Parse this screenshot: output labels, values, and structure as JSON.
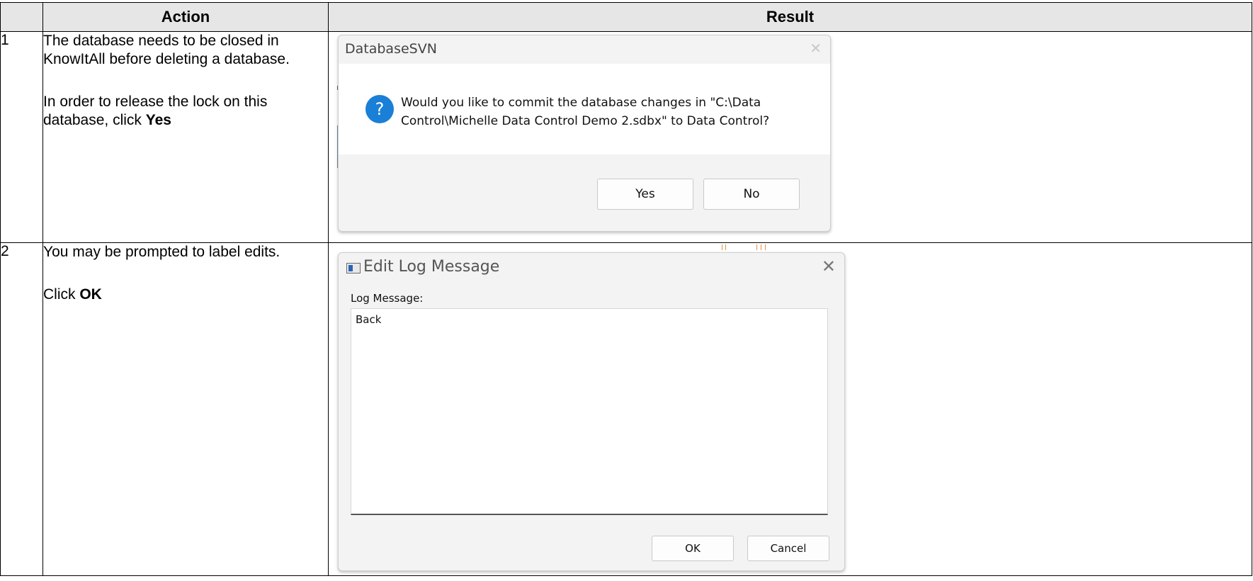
{
  "table": {
    "headers": {
      "number": "",
      "action": "Action",
      "result": "Result"
    },
    "rows": [
      {
        "number": "1",
        "action_paragraphs": [
          {
            "text": "The database needs to be closed in KnowItAll before deleting a database."
          },
          {
            "text_prefix": "In order to release the lock on this database, click ",
            "bold": "Yes"
          }
        ]
      },
      {
        "number": "2",
        "action_paragraphs": [
          {
            "text": "You may be prompted to label edits."
          },
          {
            "text_prefix": "Click ",
            "bold": "OK"
          }
        ]
      }
    ]
  },
  "dialog_commit": {
    "title": "DatabaseSVN",
    "close_glyph": "✕",
    "icon_glyph": "?",
    "message": "Would you like to commit the database changes in \"C:\\Data Control\\Michelle Data Control Demo 2.sdbx\" to Data Control?",
    "buttons": {
      "yes": "Yes",
      "no": "No"
    }
  },
  "dialog_log": {
    "title": "Edit Log Message",
    "close_glyph": "✕",
    "field_label": "Log Message:",
    "field_value": "Back",
    "buttons": {
      "ok": "OK",
      "cancel": "Cancel"
    }
  }
}
